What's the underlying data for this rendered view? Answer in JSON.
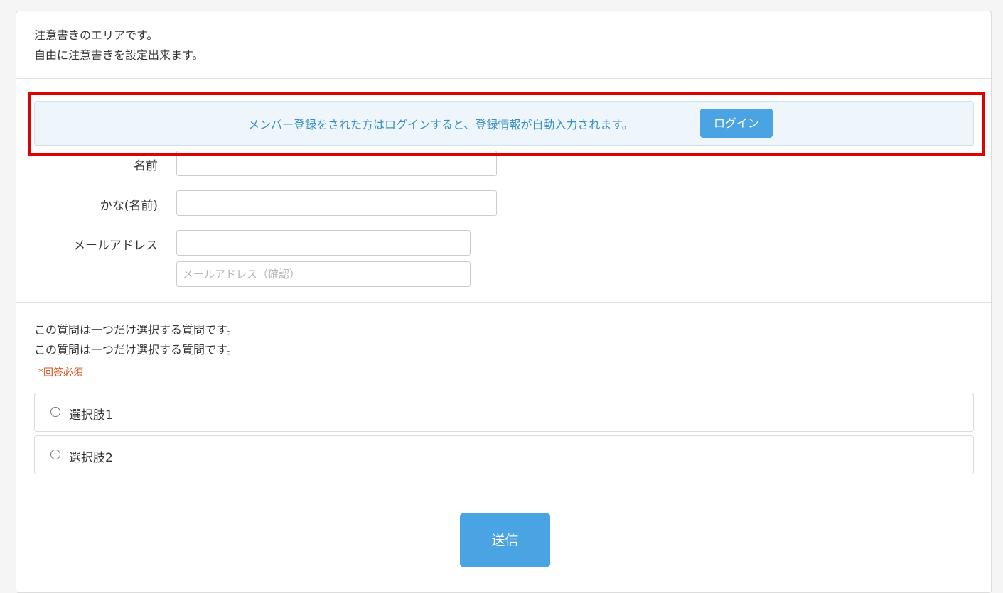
{
  "notes": {
    "line1": "注意書きのエリアです。",
    "line2": "自由に注意書きを設定出来ます。"
  },
  "login_banner": {
    "message": "メンバー登録をされた方はログインすると、登録情報が自動入力されます。",
    "button_label": "ログイン"
  },
  "form": {
    "name_label": "名前",
    "name_value": "",
    "kana_label": "かな(名前)",
    "kana_value": "",
    "email_label": "メールアドレス",
    "email_value": "",
    "email_confirm_placeholder": "メールアドレス（確認）",
    "email_confirm_value": ""
  },
  "question": {
    "line1": "この質問は一つだけ選択する質問です。",
    "line2": "この質問は一つだけ選択する質問です。",
    "required": "*回答必須",
    "options": [
      {
        "label": "選択肢1"
      },
      {
        "label": "選択肢2"
      }
    ]
  },
  "submit_label": "送信",
  "colors": {
    "accent": "#4aa3e3",
    "banner_text": "#3a8fc5",
    "banner_bg": "#eef6fc",
    "required": "#d9541e",
    "highlight": "#e00000"
  }
}
